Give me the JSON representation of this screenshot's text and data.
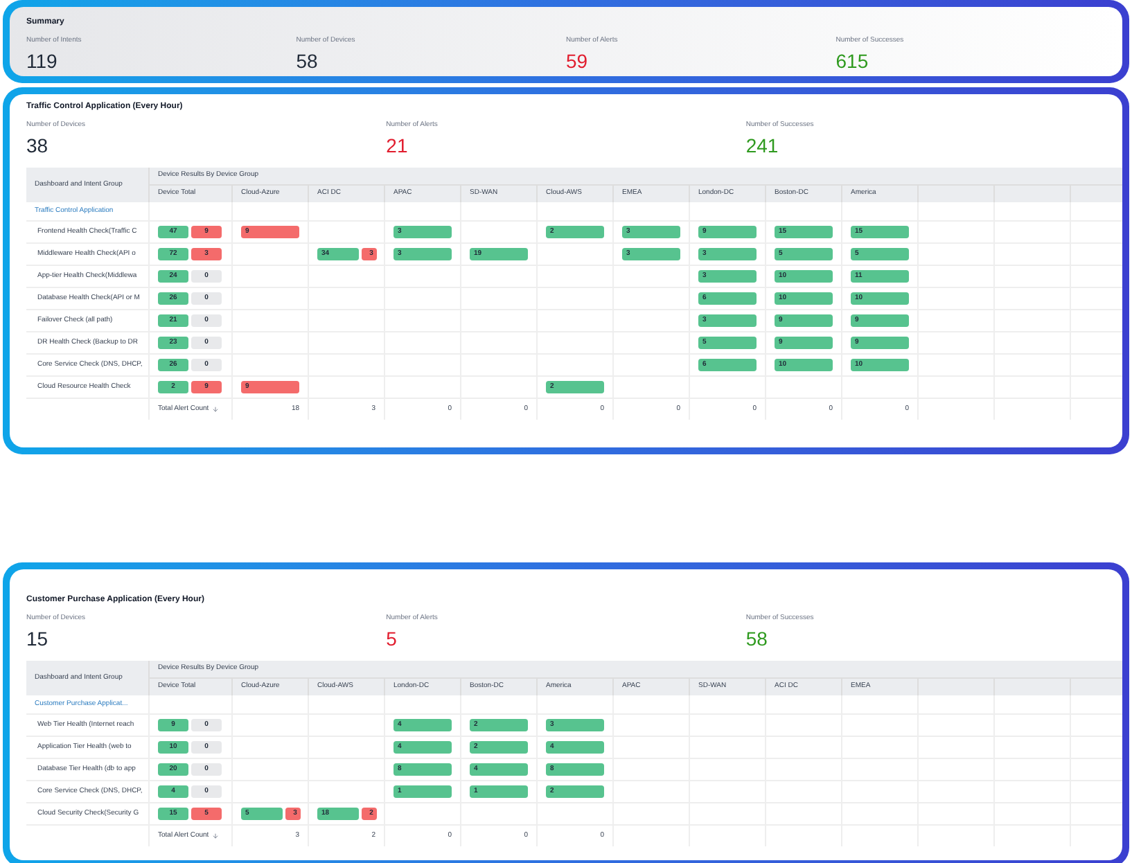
{
  "summary": {
    "title": "Summary",
    "metrics": [
      {
        "label": "Number of Intents",
        "value": "119",
        "kind": "neutral"
      },
      {
        "label": "Number of Devices",
        "value": "58",
        "kind": "neutral"
      },
      {
        "label": "Number of Alerts",
        "value": "59",
        "kind": "alert"
      },
      {
        "label": "Number of Successes",
        "value": "615",
        "kind": "success"
      }
    ]
  },
  "panels": [
    {
      "title": "Traffic Control Application (Every Hour)",
      "metrics": [
        {
          "label": "Number of Devices",
          "value": "38",
          "kind": "neutral"
        },
        {
          "label": "Number of Alerts",
          "value": "21",
          "kind": "alert"
        },
        {
          "label": "Number of Successes",
          "value": "241",
          "kind": "success"
        }
      ],
      "table": {
        "group_header": "Dashboard and Intent Group",
        "results_header": "Device Results By Device Group",
        "total_header": "Device Total",
        "columns": [
          "Cloud-Azure",
          "ACI DC",
          "APAC",
          "SD-WAN",
          "Cloud-AWS",
          "EMEA",
          "London-DC",
          "Boston-DC",
          "America"
        ],
        "group_link": "Traffic Control Application",
        "rows": [
          {
            "label": "Frontend Health Check(Traffic C",
            "total": {
              "ok": "47",
              "alerts": "9",
              "alerted": true
            },
            "cells": [
              {
                "kind": "fail",
                "value": "9"
              },
              {
                "kind": "empty"
              },
              {
                "kind": "ok",
                "value": "3"
              },
              {
                "kind": "empty"
              },
              {
                "kind": "ok",
                "value": "2"
              },
              {
                "kind": "ok",
                "value": "3"
              },
              {
                "kind": "ok",
                "value": "9"
              },
              {
                "kind": "ok",
                "value": "15"
              },
              {
                "kind": "ok",
                "value": "15"
              }
            ]
          },
          {
            "label": "Middleware Health Check(API o",
            "total": {
              "ok": "72",
              "alerts": "3",
              "alerted": true
            },
            "cells": [
              {
                "kind": "empty"
              },
              {
                "kind": "split",
                "ok": "34",
                "fail": "3"
              },
              {
                "kind": "ok",
                "value": "3"
              },
              {
                "kind": "ok",
                "value": "19"
              },
              {
                "kind": "empty"
              },
              {
                "kind": "ok",
                "value": "3"
              },
              {
                "kind": "ok",
                "value": "3"
              },
              {
                "kind": "ok",
                "value": "5"
              },
              {
                "kind": "ok",
                "value": "5"
              }
            ]
          },
          {
            "label": "App-tier Health Check(Middlewa",
            "total": {
              "ok": "24",
              "alerts": "0",
              "alerted": false
            },
            "cells": [
              {
                "kind": "empty"
              },
              {
                "kind": "empty"
              },
              {
                "kind": "empty"
              },
              {
                "kind": "empty"
              },
              {
                "kind": "empty"
              },
              {
                "kind": "empty"
              },
              {
                "kind": "ok",
                "value": "3"
              },
              {
                "kind": "ok",
                "value": "10"
              },
              {
                "kind": "ok",
                "value": "11"
              }
            ]
          },
          {
            "label": "Database Health Check(API or M",
            "total": {
              "ok": "26",
              "alerts": "0",
              "alerted": false
            },
            "cells": [
              {
                "kind": "empty"
              },
              {
                "kind": "empty"
              },
              {
                "kind": "empty"
              },
              {
                "kind": "empty"
              },
              {
                "kind": "empty"
              },
              {
                "kind": "empty"
              },
              {
                "kind": "ok",
                "value": "6"
              },
              {
                "kind": "ok",
                "value": "10"
              },
              {
                "kind": "ok",
                "value": "10"
              }
            ]
          },
          {
            "label": "Failover Check (all path)",
            "total": {
              "ok": "21",
              "alerts": "0",
              "alerted": false
            },
            "cells": [
              {
                "kind": "empty"
              },
              {
                "kind": "empty"
              },
              {
                "kind": "empty"
              },
              {
                "kind": "empty"
              },
              {
                "kind": "empty"
              },
              {
                "kind": "empty"
              },
              {
                "kind": "ok",
                "value": "3"
              },
              {
                "kind": "ok",
                "value": "9"
              },
              {
                "kind": "ok",
                "value": "9"
              }
            ]
          },
          {
            "label": "DR Health Check (Backup to DR",
            "total": {
              "ok": "23",
              "alerts": "0",
              "alerted": false
            },
            "cells": [
              {
                "kind": "empty"
              },
              {
                "kind": "empty"
              },
              {
                "kind": "empty"
              },
              {
                "kind": "empty"
              },
              {
                "kind": "empty"
              },
              {
                "kind": "empty"
              },
              {
                "kind": "ok",
                "value": "5"
              },
              {
                "kind": "ok",
                "value": "9"
              },
              {
                "kind": "ok",
                "value": "9"
              }
            ]
          },
          {
            "label": "Core Service Check (DNS, DHCP,",
            "total": {
              "ok": "26",
              "alerts": "0",
              "alerted": false
            },
            "cells": [
              {
                "kind": "empty"
              },
              {
                "kind": "empty"
              },
              {
                "kind": "empty"
              },
              {
                "kind": "empty"
              },
              {
                "kind": "empty"
              },
              {
                "kind": "empty"
              },
              {
                "kind": "ok",
                "value": "6"
              },
              {
                "kind": "ok",
                "value": "10"
              },
              {
                "kind": "ok",
                "value": "10"
              }
            ]
          },
          {
            "label": "Cloud Resource Health Check",
            "total": {
              "ok": "2",
              "alerts": "9",
              "alerted": true
            },
            "cells": [
              {
                "kind": "fail",
                "value": "9"
              },
              {
                "kind": "empty"
              },
              {
                "kind": "empty"
              },
              {
                "kind": "empty"
              },
              {
                "kind": "ok",
                "value": "2"
              },
              {
                "kind": "empty"
              },
              {
                "kind": "empty"
              },
              {
                "kind": "empty"
              },
              {
                "kind": "empty"
              }
            ]
          }
        ],
        "footer_label": "Total Alert Count",
        "footer_values": [
          "18",
          "3",
          "0",
          "0",
          "0",
          "0",
          "0",
          "0",
          "0"
        ]
      }
    },
    {
      "title": "Customer Purchase Application (Every Hour)",
      "metrics": [
        {
          "label": "Number of Devices",
          "value": "15",
          "kind": "neutral"
        },
        {
          "label": "Number of Alerts",
          "value": "5",
          "kind": "alert"
        },
        {
          "label": "Number of Successes",
          "value": "58",
          "kind": "success"
        }
      ],
      "table": {
        "group_header": "Dashboard and Intent Group",
        "results_header": "Device Results By Device Group",
        "total_header": "Device Total",
        "columns": [
          "Cloud-Azure",
          "Cloud-AWS",
          "London-DC",
          "Boston-DC",
          "America",
          "APAC",
          "SD-WAN",
          "ACI DC",
          "EMEA"
        ],
        "group_link": "Customer Purchase Applicat...",
        "rows": [
          {
            "label": "Web Tier Health (Internet reach",
            "total": {
              "ok": "9",
              "alerts": "0",
              "alerted": false
            },
            "cells": [
              {
                "kind": "empty"
              },
              {
                "kind": "empty"
              },
              {
                "kind": "ok",
                "value": "4"
              },
              {
                "kind": "ok",
                "value": "2"
              },
              {
                "kind": "ok",
                "value": "3"
              },
              {
                "kind": "empty"
              },
              {
                "kind": "empty"
              },
              {
                "kind": "empty"
              },
              {
                "kind": "empty"
              }
            ]
          },
          {
            "label": "Application Tier Health (web to",
            "total": {
              "ok": "10",
              "alerts": "0",
              "alerted": false
            },
            "cells": [
              {
                "kind": "empty"
              },
              {
                "kind": "empty"
              },
              {
                "kind": "ok",
                "value": "4"
              },
              {
                "kind": "ok",
                "value": "2"
              },
              {
                "kind": "ok",
                "value": "4"
              },
              {
                "kind": "empty"
              },
              {
                "kind": "empty"
              },
              {
                "kind": "empty"
              },
              {
                "kind": "empty"
              }
            ]
          },
          {
            "label": "Database Tier Health (db to app",
            "total": {
              "ok": "20",
              "alerts": "0",
              "alerted": false
            },
            "cells": [
              {
                "kind": "empty"
              },
              {
                "kind": "empty"
              },
              {
                "kind": "ok",
                "value": "8"
              },
              {
                "kind": "ok",
                "value": "4"
              },
              {
                "kind": "ok",
                "value": "8"
              },
              {
                "kind": "empty"
              },
              {
                "kind": "empty"
              },
              {
                "kind": "empty"
              },
              {
                "kind": "empty"
              }
            ]
          },
          {
            "label": "Core Service Check (DNS, DHCP,",
            "total": {
              "ok": "4",
              "alerts": "0",
              "alerted": false
            },
            "cells": [
              {
                "kind": "empty"
              },
              {
                "kind": "empty"
              },
              {
                "kind": "ok",
                "value": "1"
              },
              {
                "kind": "ok",
                "value": "1"
              },
              {
                "kind": "ok",
                "value": "2"
              },
              {
                "kind": "empty"
              },
              {
                "kind": "empty"
              },
              {
                "kind": "empty"
              },
              {
                "kind": "empty"
              }
            ]
          },
          {
            "label": "Cloud Security Check(Security G",
            "total": {
              "ok": "15",
              "alerts": "5",
              "alerted": true
            },
            "cells": [
              {
                "kind": "split",
                "ok": "5",
                "fail": "3"
              },
              {
                "kind": "split",
                "ok": "18",
                "fail": "2"
              },
              {
                "kind": "empty"
              },
              {
                "kind": "empty"
              },
              {
                "kind": "empty"
              },
              {
                "kind": "empty"
              },
              {
                "kind": "empty"
              },
              {
                "kind": "empty"
              },
              {
                "kind": "empty"
              }
            ]
          }
        ],
        "footer_label": "Total Alert Count",
        "footer_values": [
          "3",
          "2",
          "0",
          "0",
          "0"
        ]
      }
    }
  ]
}
